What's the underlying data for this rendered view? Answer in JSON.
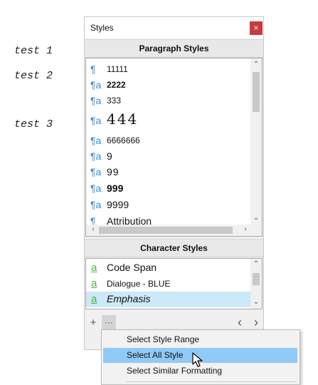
{
  "document": {
    "lines": [
      "test 1",
      "test 2",
      "test 3"
    ]
  },
  "styles_panel": {
    "title": "Styles",
    "close_icon": "×",
    "paragraph_header": "Paragraph Styles",
    "paragraph_styles": [
      {
        "label": "11111",
        "icon": "¶"
      },
      {
        "label": "2222",
        "icon": "¶a",
        "bold": true
      },
      {
        "label": "333",
        "icon": "¶a"
      },
      {
        "label": "444",
        "icon": "¶a",
        "large": true
      },
      {
        "label": "6666666",
        "icon": "¶a"
      },
      {
        "label": "9",
        "icon": "¶a"
      },
      {
        "label": "99",
        "icon": "¶a"
      },
      {
        "label": "999",
        "icon": "¶a",
        "bold": true
      },
      {
        "label": "9999",
        "icon": "¶a"
      },
      {
        "label": "Attribution",
        "icon": "¶"
      }
    ],
    "character_header": "Character Styles",
    "character_styles": [
      {
        "label": "Code  Span",
        "icon": "a"
      },
      {
        "label": "Dialogue - BLUE",
        "icon": "a"
      },
      {
        "label": "Emphasis",
        "icon": "a",
        "selected": true
      }
    ],
    "toolbar": {
      "add_icon": "+",
      "more_icon": "···",
      "prev_icon": "‹",
      "next_icon": "›"
    }
  },
  "context_menu": {
    "items": [
      "Select Style Range",
      "Select All Style",
      "Select Similar Formatting"
    ],
    "highlighted_index": 1
  },
  "colors": {
    "accent": "#3d8bc8",
    "char_icon": "#52b447",
    "close": "#c93b3b",
    "menu_highlight": "#91c9f7",
    "selection": "#cde8f8"
  }
}
